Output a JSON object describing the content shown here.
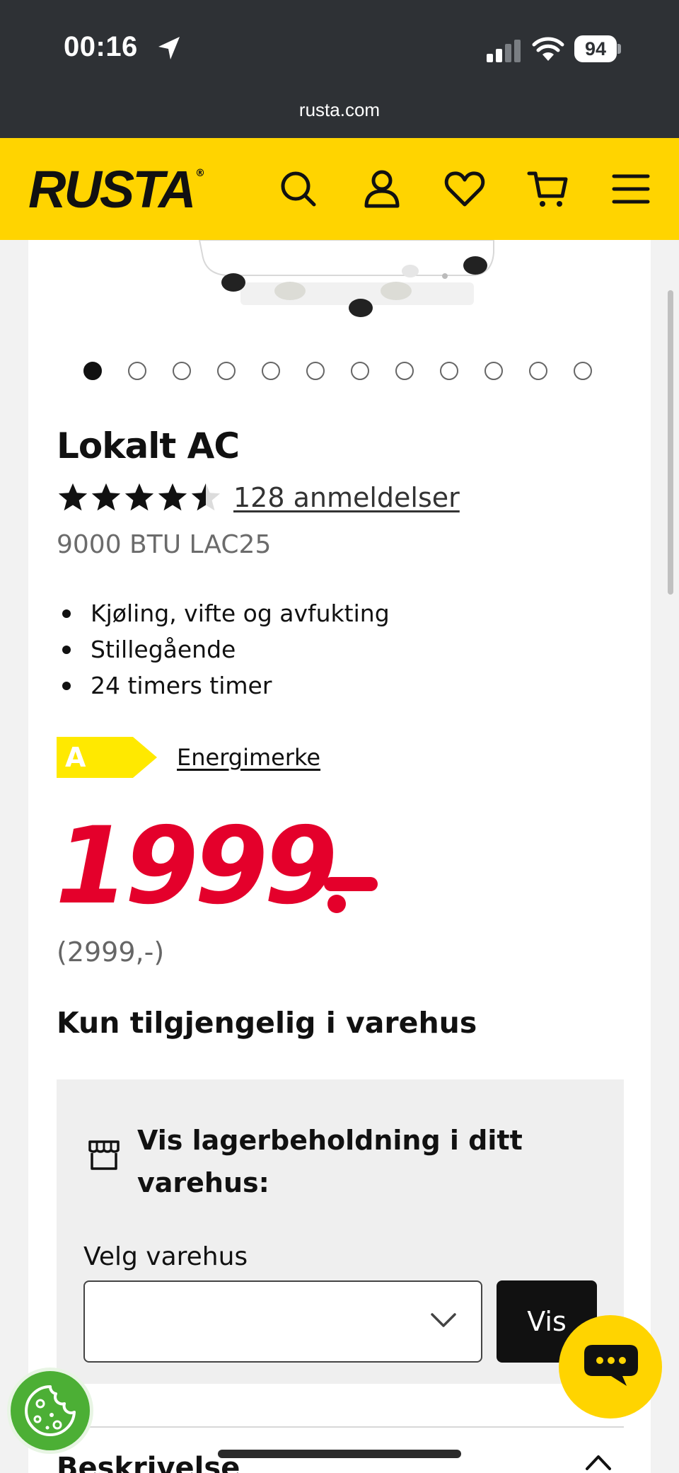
{
  "status_bar": {
    "time": "00:16",
    "battery": "94",
    "url": "rusta.com"
  },
  "header": {
    "logo": "RUSTA",
    "logo_mark": "®",
    "brand_color": "#ffd400",
    "icons": [
      "search-icon",
      "account-icon",
      "heart-icon",
      "cart-icon",
      "menu-icon"
    ]
  },
  "product": {
    "carousel_count": 12,
    "carousel_active": 1,
    "title": "Lokalt AC",
    "rating": 4.5,
    "reviews_label": "128 anmeldelser",
    "subtitle": "9000 BTU LAC25",
    "features": [
      "Kjøling, vifte og avfukting",
      "Stillegående",
      "24 timers timer"
    ],
    "energy_class": "A",
    "energy_link": "Energimerke",
    "price": "1999",
    "price_color": "#e4002b",
    "old_price": "(2999,-)",
    "availability": "Kun tilgjengelig i varehus"
  },
  "stock": {
    "title": "Vis lagerbeholdning i ditt varehus:",
    "select_label": "Velg varehus",
    "select_value": "",
    "button_label": "Vis"
  },
  "description": {
    "heading": "Beskrivelse"
  }
}
